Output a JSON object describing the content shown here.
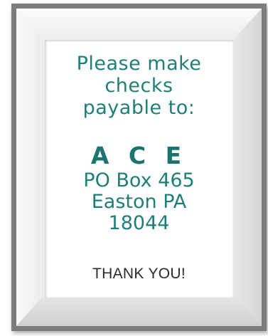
{
  "sign": {
    "intro_lines": [
      "Please make",
      "checks",
      "payable to:"
    ],
    "company": "A C E",
    "address_lines": [
      "PO Box 465",
      "Easton PA",
      "18044"
    ],
    "closing": "THANK YOU!"
  },
  "colors": {
    "text_primary": "#1f7f78",
    "text_closing": "#2b2b2b",
    "frame": "#7c7c7c",
    "mat": "#ececec"
  }
}
